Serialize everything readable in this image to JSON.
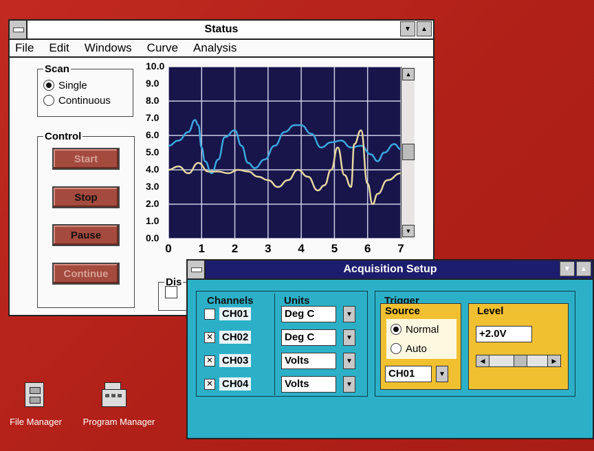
{
  "status_window": {
    "title": "Status",
    "menu": [
      "File",
      "Edit",
      "Windows",
      "Curve",
      "Analysis"
    ],
    "scan": {
      "legend": "Scan",
      "options": [
        "Single",
        "Continuous"
      ],
      "selected": "Single"
    },
    "control": {
      "legend": "Control",
      "buttons": [
        "Start",
        "Stop",
        "Pause",
        "Continue"
      ],
      "disabled": [
        "Start",
        "Continue"
      ]
    },
    "display_legend_fragment": "Dis"
  },
  "chart_data": {
    "type": "line",
    "title": "",
    "xlabel": "",
    "ylabel": "",
    "xlim": [
      0,
      7
    ],
    "ylim": [
      0,
      10
    ],
    "y_ticks": [
      "10.0",
      "9.0",
      "8.0",
      "7.0",
      "6.0",
      "5.0",
      "4.0",
      "3.0",
      "2.0",
      "1.0",
      "0.0"
    ],
    "x_ticks": [
      "0",
      "1",
      "2",
      "3",
      "4",
      "5",
      "6",
      "7"
    ],
    "grid": true,
    "series": [
      {
        "color": "#3aa8e0",
        "x": [
          0,
          0.3,
          0.6,
          0.8,
          0.9,
          1.0,
          1.1,
          1.3,
          1.5,
          1.7,
          2.0,
          2.2,
          2.4,
          2.6,
          2.9,
          3.2,
          3.5,
          3.8,
          4.0,
          4.3,
          4.6,
          4.9,
          5.2,
          5.5,
          5.8,
          6.1,
          6.3,
          6.5,
          6.8,
          7.0
        ],
        "y": [
          5.4,
          5.7,
          6.2,
          6.9,
          6.6,
          5.3,
          4.5,
          3.8,
          4.6,
          5.9,
          6.3,
          5.4,
          4.4,
          4.1,
          4.6,
          5.4,
          6.2,
          6.6,
          6.6,
          6.1,
          5.3,
          5.6,
          5.7,
          5.3,
          5.4,
          4.9,
          4.5,
          5.0,
          5.5,
          5.2
        ]
      },
      {
        "color": "#e8d8a0",
        "x": [
          0,
          0.3,
          0.6,
          0.9,
          1.2,
          1.5,
          1.8,
          2.1,
          2.4,
          2.7,
          3.0,
          3.3,
          3.6,
          3.9,
          4.2,
          4.5,
          4.7,
          4.9,
          5.1,
          5.3,
          5.5,
          5.6,
          5.8,
          6.0,
          6.15,
          6.3,
          6.6,
          7.0
        ],
        "y": [
          4.0,
          4.2,
          3.8,
          4.4,
          3.9,
          3.9,
          3.8,
          4.0,
          3.9,
          3.6,
          3.4,
          3.0,
          3.4,
          4.0,
          3.6,
          2.8,
          3.1,
          4.0,
          5.3,
          3.7,
          3.0,
          5.5,
          6.3,
          3.2,
          2.0,
          2.6,
          3.4,
          3.8
        ]
      }
    ]
  },
  "acq_window": {
    "title": "Acquisition Setup",
    "channels_legend": "Channels",
    "units_legend": "Units",
    "channels": [
      {
        "name": "CH01",
        "checked": false,
        "unit": "Deg C"
      },
      {
        "name": "CH02",
        "checked": true,
        "unit": "Deg C"
      },
      {
        "name": "CH03",
        "checked": true,
        "unit": "Volts"
      },
      {
        "name": "CH04",
        "checked": true,
        "unit": "Volts"
      }
    ],
    "trigger": {
      "legend": "Trigger",
      "source_legend": "Source",
      "source_options": [
        "Normal",
        "Auto"
      ],
      "source_selected": "Normal",
      "source_channel": "CH01",
      "level_legend": "Level",
      "level_value": "+2.0V"
    }
  },
  "desktop_icons": [
    {
      "label": "File Manager",
      "icon": "file-cabinet-icon"
    },
    {
      "label": "Program Manager",
      "icon": "program-group-icon"
    }
  ],
  "colors": {
    "desktop": "#b8241c",
    "plot_bg": "#17154a",
    "acq_bg": "#2cb0c8",
    "acq_title": "#1d1d6e",
    "trigger_panel": "#f0c030"
  }
}
